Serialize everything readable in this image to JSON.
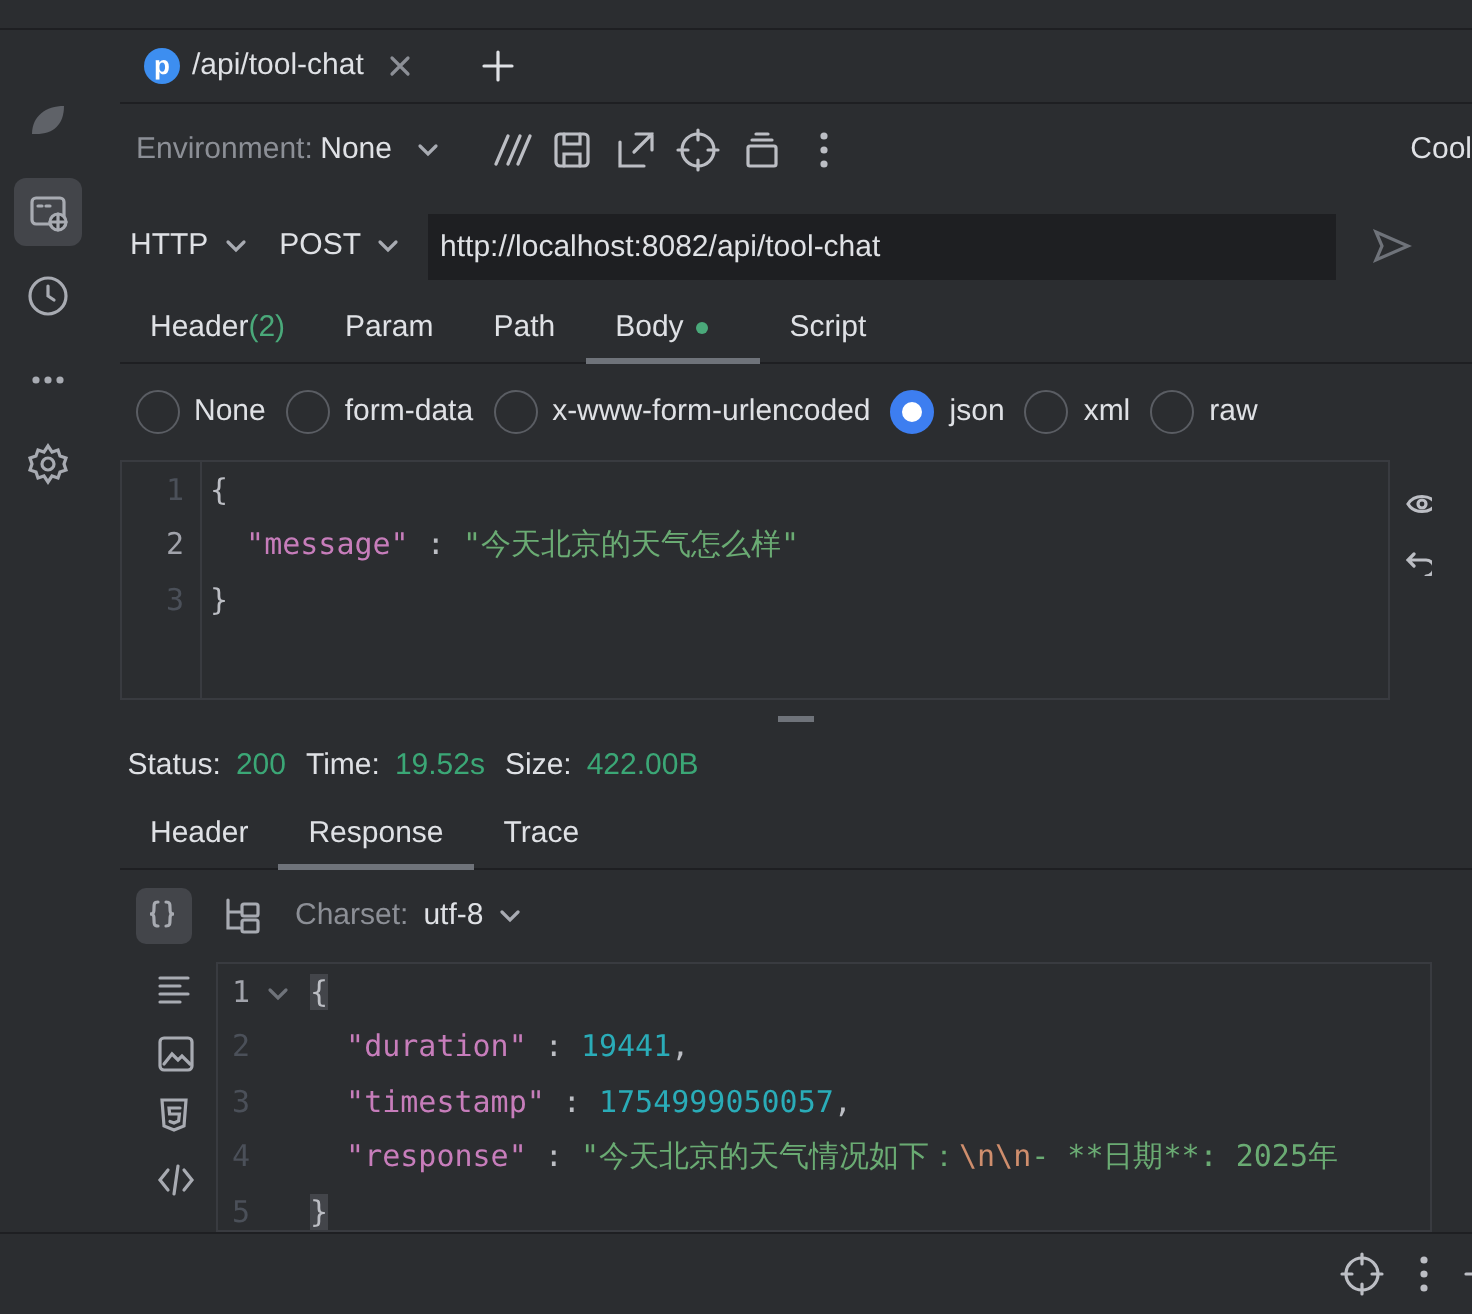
{
  "sidebar": {
    "items": [
      {
        "kind": "leaf",
        "selected": false
      },
      {
        "kind": "api",
        "selected": true
      },
      {
        "kind": "history",
        "selected": false
      },
      {
        "kind": "more",
        "selected": false
      },
      {
        "kind": "settings",
        "selected": false
      }
    ]
  },
  "file_tab": {
    "badge": "p",
    "label": "/api/tool-chat"
  },
  "toolbar": {
    "environment_label": "Environment:",
    "environment_value": "None",
    "right_label": "Cool"
  },
  "request": {
    "protocol": "HTTP",
    "method": "POST",
    "url": "http://localhost:8082/api/tool-chat"
  },
  "request_tabs": [
    {
      "label": "Header",
      "count": "(2)",
      "modified": false,
      "selected": false
    },
    {
      "label": "Param",
      "modified": false,
      "selected": false
    },
    {
      "label": "Path",
      "modified": false,
      "selected": false
    },
    {
      "label": "Body",
      "modified": true,
      "selected": true
    },
    {
      "label": "Script",
      "modified": false,
      "selected": false
    }
  ],
  "body_types": [
    {
      "label": "None",
      "selected": false
    },
    {
      "label": "form-data",
      "selected": false
    },
    {
      "label": "x-www-form-urlencoded",
      "selected": false
    },
    {
      "label": "json",
      "selected": true
    },
    {
      "label": "xml",
      "selected": false
    },
    {
      "label": "raw",
      "selected": false
    }
  ],
  "request_body": {
    "lines": [
      {
        "number": "1",
        "current": false,
        "tokens": [
          {
            "kind": "punct",
            "text": "{"
          }
        ]
      },
      {
        "number": "2",
        "current": true,
        "tokens": [
          {
            "kind": "key",
            "text": "  \"message\""
          },
          {
            "kind": "punct",
            "text": " : "
          },
          {
            "kind": "string",
            "text": "\"今天北京的天气怎么样\""
          }
        ]
      },
      {
        "number": "3",
        "current": false,
        "tokens": [
          {
            "kind": "punct",
            "text": "}"
          }
        ]
      }
    ]
  },
  "status": [
    {
      "label": "Status:",
      "value": "200"
    },
    {
      "label": "Time:",
      "value": "19.52s"
    },
    {
      "label": "Size:",
      "value": "422.00B"
    }
  ],
  "response_tabs": [
    {
      "label": "Header",
      "selected": false
    },
    {
      "label": "Response",
      "selected": true
    },
    {
      "label": "Trace",
      "selected": false
    }
  ],
  "response_toolbar": {
    "charset_label": "Charset:",
    "charset_value": "utf-8"
  },
  "view_modes": [
    {
      "kind": "json",
      "selected": true
    },
    {
      "kind": "text",
      "selected": false
    },
    {
      "kind": "image",
      "selected": false
    },
    {
      "kind": "html",
      "selected": false
    },
    {
      "kind": "code",
      "selected": false
    }
  ],
  "response_body": {
    "lines": [
      {
        "number": "1",
        "current": true,
        "foldable": true,
        "tokens": [
          {
            "kind": "brace",
            "text": "{"
          }
        ]
      },
      {
        "number": "2",
        "current": false,
        "foldable": false,
        "tokens": [
          {
            "kind": "key",
            "text": "  \"duration\""
          },
          {
            "kind": "punct",
            "text": " : "
          },
          {
            "kind": "number",
            "text": "19441"
          },
          {
            "kind": "punct",
            "text": ","
          }
        ]
      },
      {
        "number": "3",
        "current": false,
        "foldable": false,
        "tokens": [
          {
            "kind": "key",
            "text": "  \"timestamp\""
          },
          {
            "kind": "punct",
            "text": " : "
          },
          {
            "kind": "number",
            "text": "1754999050057"
          },
          {
            "kind": "punct",
            "text": ","
          }
        ]
      },
      {
        "number": "4",
        "current": false,
        "foldable": false,
        "tokens": [
          {
            "kind": "key",
            "text": "  \"response\""
          },
          {
            "kind": "punct",
            "text": " : "
          },
          {
            "kind": "string",
            "text": "\"今天北京的天气情况如下："
          },
          {
            "kind": "escape",
            "text": "\\n\\n"
          },
          {
            "kind": "string",
            "text": "- **日期**: 2025年"
          }
        ]
      },
      {
        "number": "5",
        "current": false,
        "foldable": false,
        "tokens": [
          {
            "kind": "brace",
            "text": "}"
          }
        ]
      }
    ]
  }
}
